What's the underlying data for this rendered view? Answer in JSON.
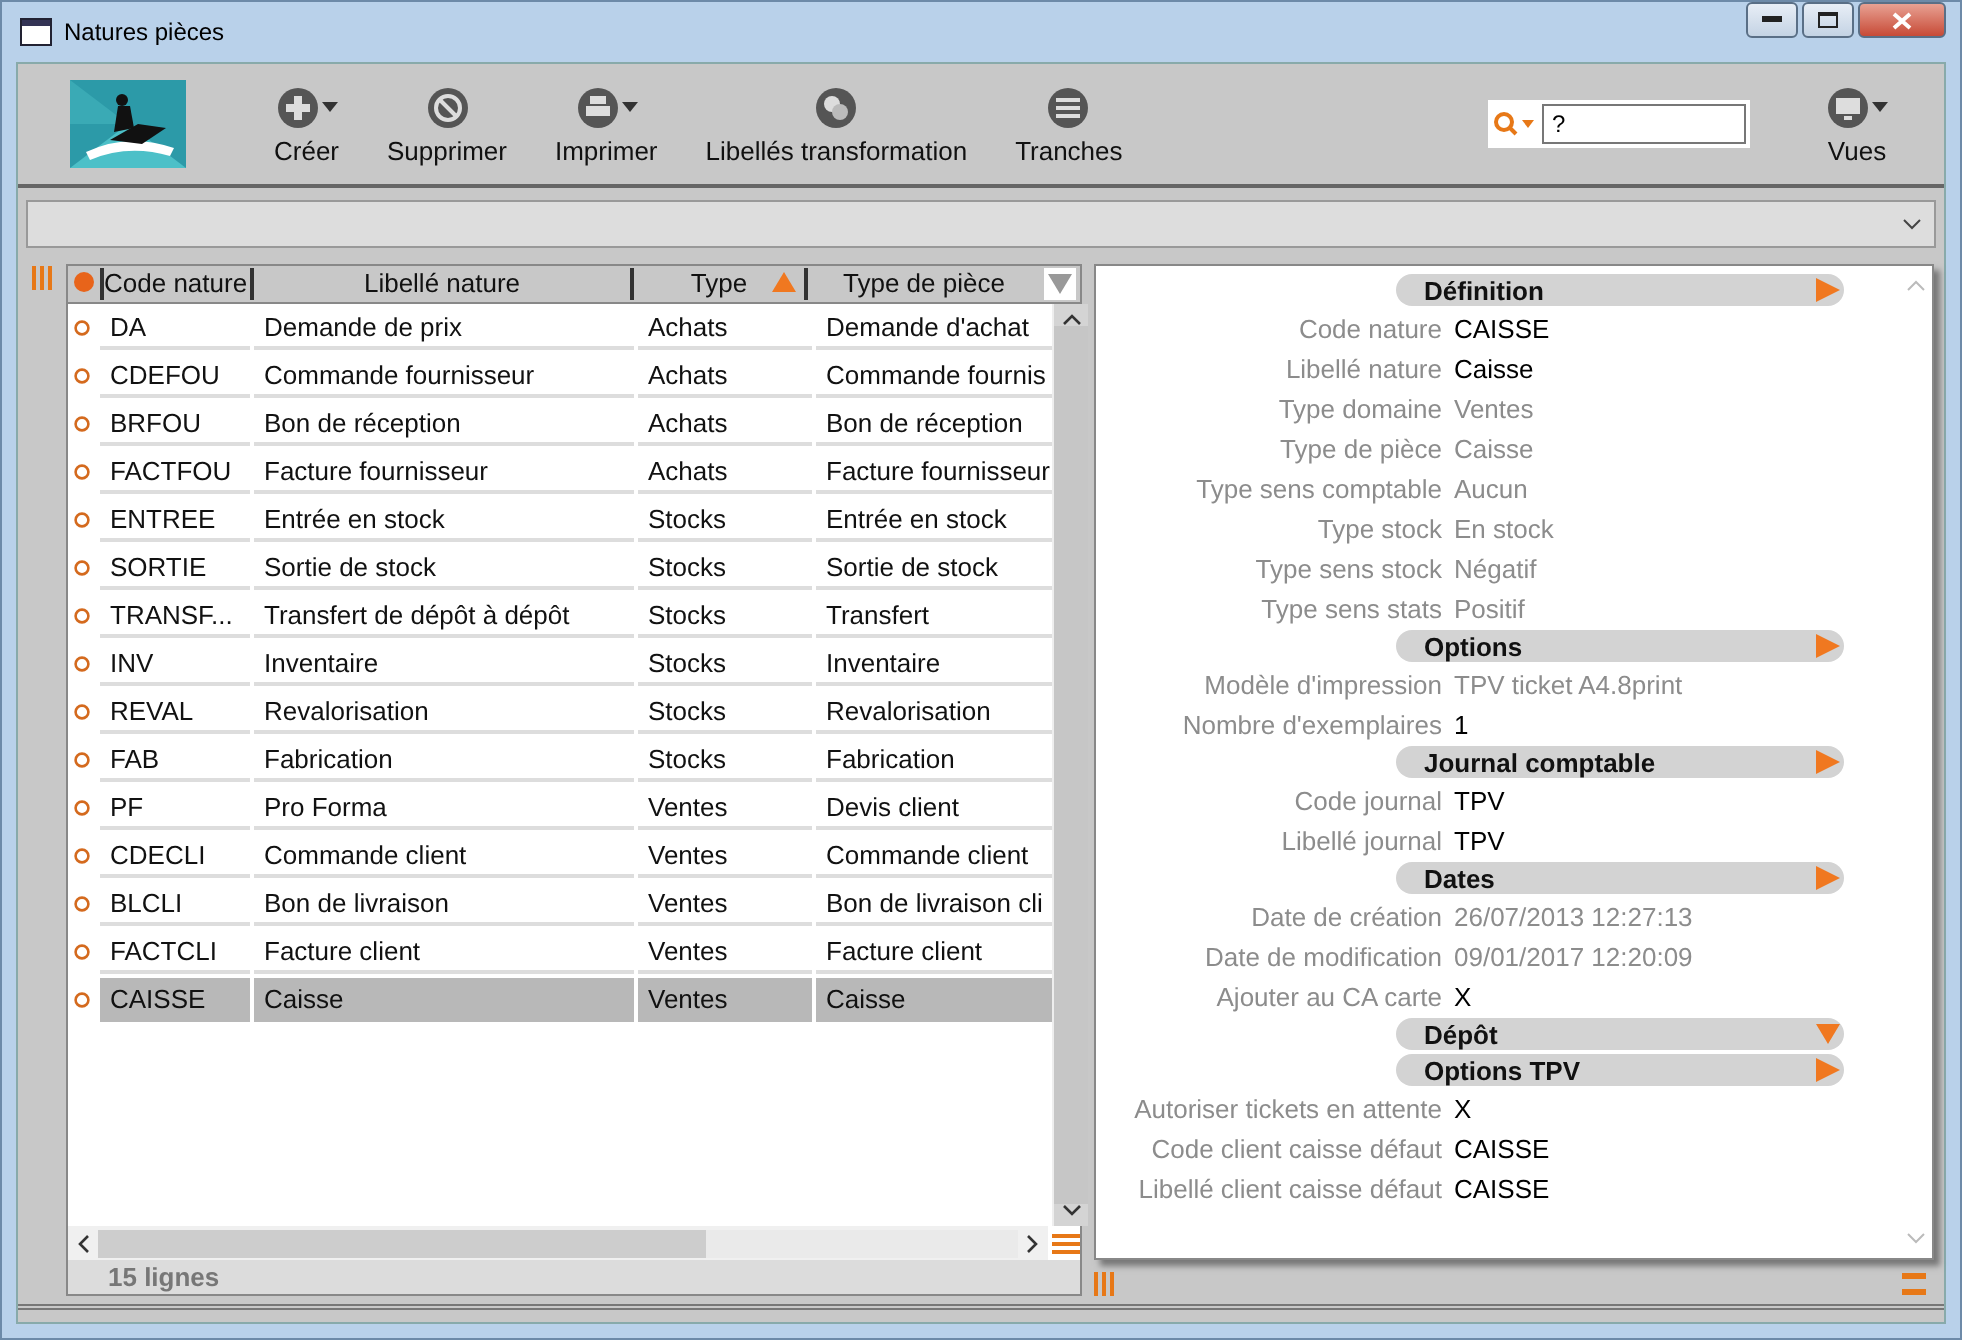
{
  "window": {
    "title": "Natures pièces"
  },
  "toolbar": [
    {
      "label": "Créer",
      "kind": "plus",
      "menu": true
    },
    {
      "label": "Supprimer",
      "kind": "forbid",
      "menu": false
    },
    {
      "label": "Imprimer",
      "kind": "print",
      "menu": true
    },
    {
      "label": "Libellés transformation",
      "kind": "circles",
      "menu": false
    },
    {
      "label": "Tranches",
      "kind": "stack",
      "menu": false
    }
  ],
  "search": {
    "value": "?"
  },
  "views": {
    "label": "Vues"
  },
  "table": {
    "columns": [
      {
        "label": "Code nature",
        "sorted": false
      },
      {
        "label": "Libellé nature",
        "sorted": false
      },
      {
        "label": "Type",
        "sorted": true
      },
      {
        "label": "Type de pièce",
        "sorted": false
      }
    ],
    "rows": [
      {
        "cells": [
          "DA",
          "Demande de prix",
          "Achats",
          "Demande d'achat"
        ],
        "selected": false
      },
      {
        "cells": [
          "CDEFOU",
          "Commande fournisseur",
          "Achats",
          "Commande fournis"
        ],
        "selected": false
      },
      {
        "cells": [
          "BRFOU",
          "Bon de réception",
          "Achats",
          "Bon de réception"
        ],
        "selected": false
      },
      {
        "cells": [
          "FACTFOU",
          "Facture fournisseur",
          "Achats",
          "Facture fournisseur"
        ],
        "selected": false
      },
      {
        "cells": [
          "ENTREE",
          "Entrée en stock",
          "Stocks",
          "Entrée en stock"
        ],
        "selected": false
      },
      {
        "cells": [
          "SORTIE",
          "Sortie de stock",
          "Stocks",
          "Sortie de stock"
        ],
        "selected": false
      },
      {
        "cells": [
          "TRANSF...",
          "Transfert de dépôt à dépôt",
          "Stocks",
          "Transfert"
        ],
        "selected": false
      },
      {
        "cells": [
          "INV",
          "Inventaire",
          "Stocks",
          "Inventaire"
        ],
        "selected": false
      },
      {
        "cells": [
          "REVAL",
          "Revalorisation",
          "Stocks",
          "Revalorisation"
        ],
        "selected": false
      },
      {
        "cells": [
          "FAB",
          "Fabrication",
          "Stocks",
          "Fabrication"
        ],
        "selected": false
      },
      {
        "cells": [
          "PF",
          "Pro Forma",
          "Ventes",
          "Devis client"
        ],
        "selected": false
      },
      {
        "cells": [
          "CDECLI",
          "Commande client",
          "Ventes",
          "Commande client"
        ],
        "selected": false
      },
      {
        "cells": [
          "BLCLI",
          "Bon de livraison",
          "Ventes",
          "Bon de livraison cli"
        ],
        "selected": false
      },
      {
        "cells": [
          "FACTCLI",
          "Facture client",
          "Ventes",
          "Facture client"
        ],
        "selected": false
      },
      {
        "cells": [
          "CAISSE",
          "Caisse",
          "Ventes",
          "Caisse"
        ],
        "selected": true
      }
    ],
    "footer": "15 lignes"
  },
  "detail": [
    {
      "title": "Définition",
      "collapsed": false,
      "fields": [
        {
          "label": "Code nature",
          "value": "CAISSE",
          "readonly": false
        },
        {
          "label": "Libellé nature",
          "value": "Caisse",
          "readonly": false
        },
        {
          "label": "Type domaine",
          "value": "Ventes",
          "readonly": true
        },
        {
          "label": "Type de pièce",
          "value": "Caisse",
          "readonly": true
        },
        {
          "label": "Type sens comptable",
          "value": "Aucun",
          "readonly": true
        },
        {
          "label": "Type stock",
          "value": "En stock",
          "readonly": true
        },
        {
          "label": "Type sens stock",
          "value": "Négatif",
          "readonly": true
        },
        {
          "label": "Type sens stats",
          "value": "Positif",
          "readonly": true
        }
      ]
    },
    {
      "title": "Options",
      "collapsed": false,
      "fields": [
        {
          "label": "Modèle d'impression",
          "value": "TPV ticket A4.8print",
          "readonly": true
        },
        {
          "label": "Nombre d'exemplaires",
          "value": "1",
          "readonly": false
        }
      ]
    },
    {
      "title": "Journal comptable",
      "collapsed": false,
      "fields": [
        {
          "label": "Code journal",
          "value": "TPV",
          "readonly": false
        },
        {
          "label": "Libellé journal",
          "value": "TPV",
          "readonly": false
        }
      ]
    },
    {
      "title": "Dates",
      "collapsed": false,
      "fields": [
        {
          "label": "Date de création",
          "value": "26/07/2013 12:27:13",
          "readonly": true
        },
        {
          "label": "Date de modification",
          "value": "09/01/2017 12:20:09",
          "readonly": true
        },
        {
          "label": "Ajouter au CA carte",
          "value": "X",
          "readonly": false
        }
      ]
    },
    {
      "title": "Dépôt",
      "collapsed": true
    },
    {
      "title": "Options TPV",
      "collapsed": false,
      "fields": [
        {
          "label": "Autoriser tickets en attente",
          "value": "X",
          "readonly": false
        },
        {
          "label": "Code client caisse défaut",
          "value": "CAISSE",
          "readonly": false
        },
        {
          "label": "Libellé client caisse défaut",
          "value": "CAISSE",
          "readonly": false
        }
      ]
    }
  ]
}
